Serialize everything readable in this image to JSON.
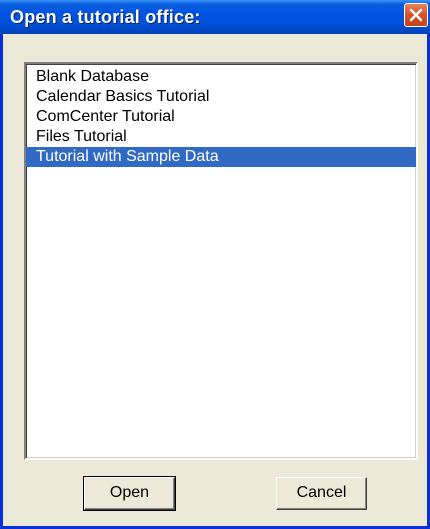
{
  "dialog": {
    "title": "Open a tutorial office:",
    "close_icon": "close-icon"
  },
  "list": {
    "items": [
      {
        "label": "Blank Database",
        "selected": false
      },
      {
        "label": "Calendar Basics Tutorial",
        "selected": false
      },
      {
        "label": "ComCenter Tutorial",
        "selected": false
      },
      {
        "label": "Files Tutorial",
        "selected": false
      },
      {
        "label": "Tutorial with Sample Data",
        "selected": true
      }
    ]
  },
  "buttons": {
    "open_label": "Open",
    "cancel_label": "Cancel"
  },
  "colors": {
    "titlebar": "#0054e3",
    "selection": "#316ac5",
    "dialog_bg": "#ece9d8"
  }
}
